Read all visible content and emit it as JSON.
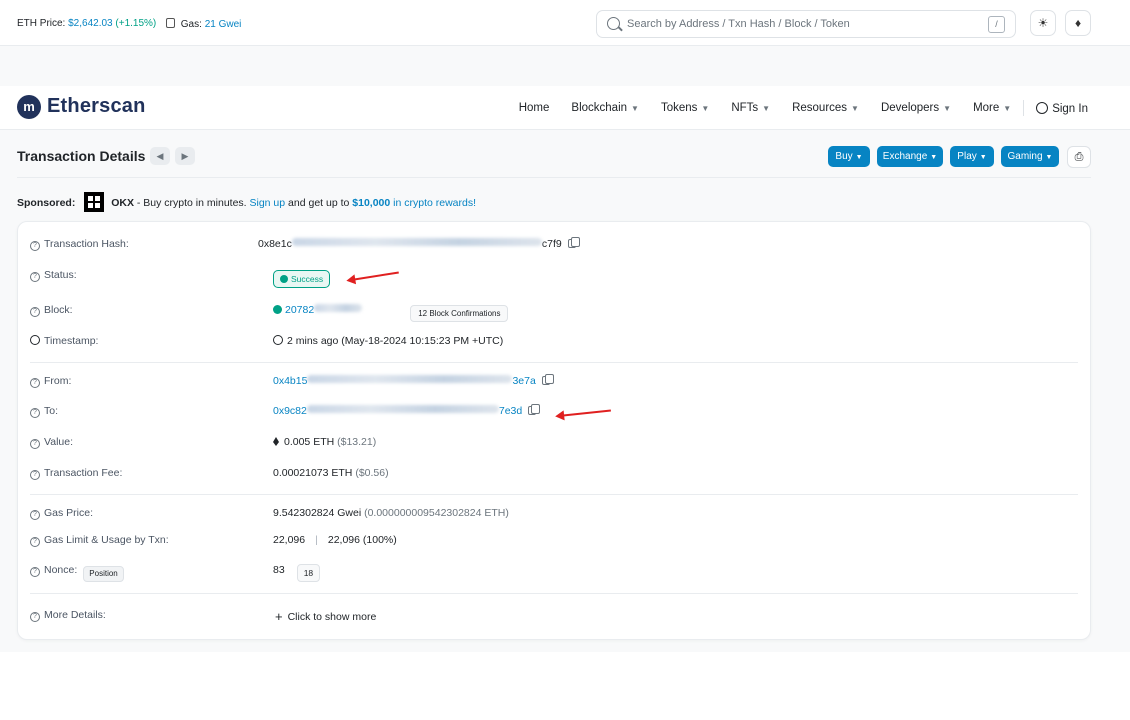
{
  "topbar": {
    "eth_price_label": "ETH Price:",
    "eth_price_value": "$2,642.03",
    "eth_price_change": "(+1.15%)",
    "gas_label": "Gas:",
    "gas_value": "21 Gwei",
    "search_placeholder": "Search by Address / Txn Hash / Block / Token",
    "search_shortcut": "/"
  },
  "navbar": {
    "brand": "Etherscan",
    "items": [
      "Home",
      "Blockchain",
      "Tokens",
      "NFTs",
      "Resources",
      "Developers",
      "More"
    ],
    "sign_in": "Sign In"
  },
  "page": {
    "title": "Transaction Details",
    "actions": [
      "Buy",
      "Exchange",
      "Play",
      "Gaming"
    ]
  },
  "sponsored": {
    "label": "Sponsored:",
    "brand": "OKX",
    "text_1": " - Buy crypto in minutes. ",
    "link_1": "Sign up",
    "text_2": " and get up to ",
    "link_2": "$10,000",
    "link_3": " in crypto rewards!"
  },
  "details": {
    "tx_hash_label": "Transaction Hash:",
    "tx_hash_start": "0x8e1c",
    "tx_hash_end": "c7f9",
    "status_label": "Status:",
    "status_value": "Success",
    "block_label": "Block:",
    "block_value": "20782",
    "block_confirmations": "12 Block Confirmations",
    "timestamp_label": "Timestamp:",
    "timestamp_value": "2 mins ago (May-18-2024 10:15:23 PM +UTC)",
    "from_label": "From:",
    "from_start": "0x4b15",
    "from_end": "3e7a",
    "to_label": "To:",
    "to_start": "0x9c82",
    "to_end": "7e3d",
    "value_label": "Value:",
    "value_eth": "0.005 ETH",
    "value_usd": "($13.21)",
    "fee_label": "Transaction Fee:",
    "fee_eth": "0.00021073 ETH",
    "fee_usd": "($0.56)",
    "gas_price_label": "Gas Price:",
    "gas_price_gwei": "9.542302824 Gwei",
    "gas_price_eth": "(0.000000009542302824 ETH)",
    "gas_limit_label": "Gas Limit & Usage by Txn:",
    "gas_limit": "22,096",
    "gas_usage": "22,096 (100%)",
    "nonce_label": "Nonce:",
    "nonce_badge": "Position",
    "nonce_value": "83",
    "position_value": "18",
    "more_label": "More Details:",
    "more_link": "Click to show more"
  },
  "colors": {
    "link_blue": "#0784c3",
    "success_green": "#00a186",
    "annotation_red": "#e02020",
    "brand_navy": "#21325b"
  }
}
